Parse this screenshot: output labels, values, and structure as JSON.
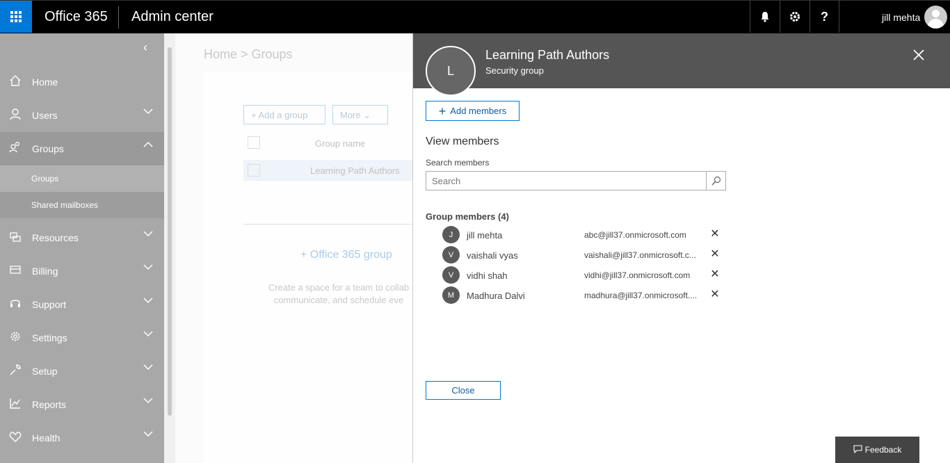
{
  "topbar": {
    "brand": "Office 365",
    "app_name": "Admin center",
    "user_name": "jill mehta",
    "icons": [
      "app-launcher-icon",
      "bell-icon",
      "gear-icon",
      "help-icon"
    ]
  },
  "sidebar": {
    "items": [
      {
        "label": "Home",
        "icon": "home-icon"
      },
      {
        "label": "Users",
        "icon": "person-icon"
      },
      {
        "label": "Groups",
        "icon": "group-icon"
      },
      {
        "label": "Resources",
        "icon": "resources-icon"
      },
      {
        "label": "Billing",
        "icon": "billing-icon"
      },
      {
        "label": "Support",
        "icon": "headset-icon"
      },
      {
        "label": "Settings",
        "icon": "gear-icon"
      },
      {
        "label": "Setup",
        "icon": "wrench-icon"
      },
      {
        "label": "Reports",
        "icon": "chart-icon"
      },
      {
        "label": "Health",
        "icon": "heart-icon"
      }
    ],
    "sub_items": [
      {
        "label": "Groups"
      },
      {
        "label": "Shared mailboxes"
      }
    ]
  },
  "main": {
    "breadcrumb": "Home > Groups",
    "add_group_label": "Add a group",
    "more_label": "More",
    "column_group_name": "Group name",
    "row_name": "Learning Path Authors",
    "office_group_label": "Office 365 group",
    "description_line1": "Create a space for a team to collab",
    "description_line2": "communicate, and schedule eve"
  },
  "panel": {
    "avatar_initial": "L",
    "title": "Learning Path Authors",
    "subtitle": "Security group",
    "add_members_label": "Add members",
    "view_members_title": "View members",
    "search_label": "Search members",
    "search_placeholder": "Search",
    "members_title": "Group members (4)",
    "members": [
      {
        "initial": "J",
        "name": "jill mehta",
        "email": "abc@jill37.onmicrosoft.com"
      },
      {
        "initial": "V",
        "name": "vaishali vyas",
        "email": "vaishali@jill37.onmicrosoft.c..."
      },
      {
        "initial": "V",
        "name": "vidhi shah",
        "email": "vidhi@jill37.onmicrosoft.com"
      },
      {
        "initial": "M",
        "name": "Madhura Dalvi",
        "email": "madhura@jill37.onmicrosoft...."
      }
    ],
    "close_label": "Close",
    "feedback_label": "Feedback"
  },
  "colors": {
    "accent": "#0078d7",
    "topbar_bg": "#000000",
    "sidebar_bg": "#a8a8a8",
    "panel_header_bg": "#555555"
  }
}
